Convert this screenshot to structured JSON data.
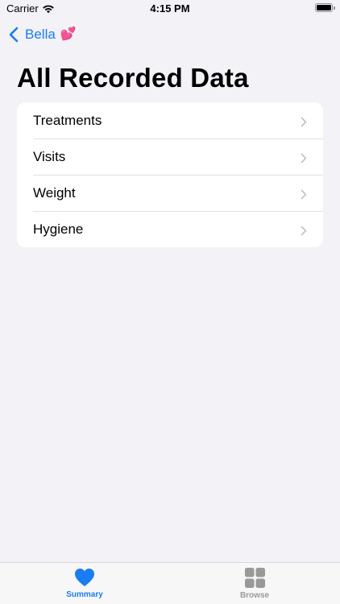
{
  "status_bar": {
    "carrier": "Carrier",
    "time": "4:15 PM",
    "battery_level": 1.0
  },
  "nav": {
    "back_label": "Bella",
    "back_emoji": "💕",
    "back_icon": "chevron-left-icon"
  },
  "page": {
    "title": "All Recorded Data"
  },
  "list": {
    "items": [
      {
        "label": "Treatments"
      },
      {
        "label": "Visits"
      },
      {
        "label": "Weight"
      },
      {
        "label": "Hygiene"
      }
    ],
    "accessory_icon": "chevron-right-icon"
  },
  "tab_bar": {
    "tabs": [
      {
        "label": "Summary",
        "icon": "heart-icon",
        "selected": true
      },
      {
        "label": "Browse",
        "icon": "grid-icon",
        "selected": false
      }
    ]
  },
  "colors": {
    "accent": "#1a7cf2",
    "background": "#f2f2f7",
    "inactive_tab": "#999999"
  }
}
